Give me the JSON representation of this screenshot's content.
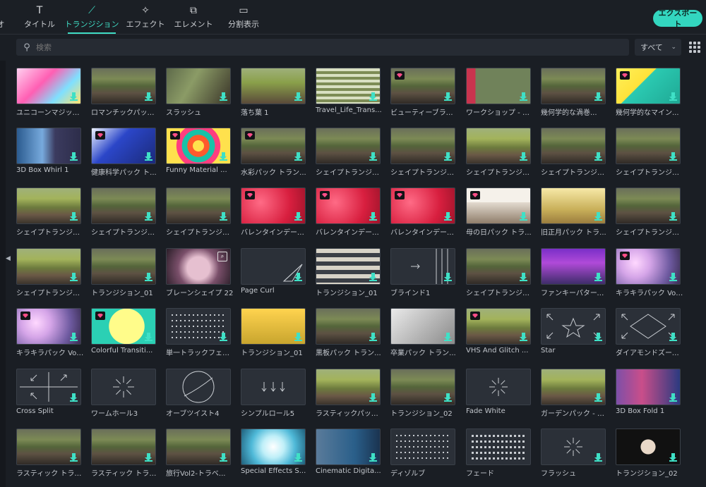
{
  "tabs": [
    {
      "label": "オ",
      "icon": "audio-icon",
      "active": false
    },
    {
      "label": "タイトル",
      "icon": "title-T-icon",
      "active": false
    },
    {
      "label": "トランジション",
      "icon": "transition-icon",
      "active": true
    },
    {
      "label": "エフェクト",
      "icon": "effect-icon",
      "active": false
    },
    {
      "label": "エレメント",
      "icon": "element-icon",
      "active": false
    },
    {
      "label": "分割表示",
      "icon": "split-screen-icon",
      "active": false
    }
  ],
  "export_label": "エクスポート",
  "search": {
    "placeholder": "検索"
  },
  "filter": {
    "value": "すべて"
  },
  "items": [
    {
      "label": "ユニコーンマジック...",
      "style": "p-pink",
      "gem": false,
      "dl": true
    },
    {
      "label": "ロマンチックパック ...",
      "style": "p-photo",
      "gem": false,
      "dl": true
    },
    {
      "label": "スラッシュ",
      "style": "p-slash",
      "gem": false,
      "dl": true
    },
    {
      "label": "落ち葉 1",
      "style": "p-leaf",
      "gem": false,
      "dl": true
    },
    {
      "label": "Travel_Life_Trans...",
      "style": "p-travel",
      "gem": false,
      "dl": true
    },
    {
      "label": "ビューティーブラシ - ...",
      "style": "p-photo",
      "gem": true,
      "dl": true
    },
    {
      "label": "ワークショップ - ト...",
      "style": "p-redbar",
      "gem": false,
      "dl": true
    },
    {
      "label": "幾何学的な渦巻...",
      "style": "p-photo",
      "gem": false,
      "dl": true
    },
    {
      "label": "幾何学的なマイン...",
      "style": "p-teal",
      "gem": true,
      "dl": true
    },
    {
      "label": "3D Box Whirl 1",
      "style": "p-box",
      "gem": false,
      "dl": true
    },
    {
      "label": "健康科学パック ト...",
      "style": "p-health",
      "gem": true,
      "dl": true
    },
    {
      "label": "Funny Material ...",
      "style": "p-funny",
      "gem": true,
      "dl": true
    },
    {
      "label": "水彩パック トラン...",
      "style": "p-photo",
      "gem": true,
      "dl": true
    },
    {
      "label": "シェイプトランジショ...",
      "style": "p-photo",
      "gem": false,
      "dl": true
    },
    {
      "label": "シェイプトランジショ...",
      "style": "p-photo",
      "gem": false,
      "dl": true
    },
    {
      "label": "シェイプトランジショ...",
      "style": "p-garden",
      "gem": false,
      "dl": true
    },
    {
      "label": "シェイプトランジショ...",
      "style": "p-photo",
      "gem": false,
      "dl": true
    },
    {
      "label": "シェイプトランジショ...",
      "style": "p-photo",
      "gem": false,
      "dl": true
    },
    {
      "label": "シェイプトランジショ...",
      "style": "p-garden",
      "gem": false,
      "dl": true
    },
    {
      "label": "シェイプトランジショ...",
      "style": "p-photo",
      "gem": false,
      "dl": true
    },
    {
      "label": "シェイプトランジショ...",
      "style": "p-photo",
      "gem": false,
      "dl": true
    },
    {
      "label": "バレンタインデーパ...",
      "style": "p-red",
      "gem": true,
      "dl": true
    },
    {
      "label": "バレンタインデーパ...",
      "style": "p-red",
      "gem": true,
      "dl": true
    },
    {
      "label": "バレンタインデーパ...",
      "style": "p-red",
      "gem": true,
      "dl": true
    },
    {
      "label": "母の日パック トラ...",
      "style": "p-mother",
      "gem": true,
      "dl": true
    },
    {
      "label": "旧正月パック トラ...",
      "style": "p-gold",
      "gem": false,
      "dl": true
    },
    {
      "label": "シェイプトランジショ...",
      "style": "p-photo",
      "gem": false,
      "dl": true
    },
    {
      "label": "シェイプトランジショ...",
      "style": "p-garden",
      "gem": false,
      "dl": true
    },
    {
      "label": "トランジション_01",
      "style": "p-photo",
      "gem": false,
      "dl": true
    },
    {
      "label": "ブレーンシェイプ 22",
      "style": "p-flower",
      "gem": false,
      "dl": false,
      "zoom": true
    },
    {
      "label": "Page Curl",
      "style": "p-dark",
      "gem": false,
      "dl": true,
      "icon": "pagecurl"
    },
    {
      "label": "トランジション_01",
      "style": "p-stripe",
      "gem": false,
      "dl": true
    },
    {
      "label": "ブラインド1",
      "style": "p-dark",
      "gem": false,
      "dl": true,
      "icon": "blind"
    },
    {
      "label": "シェイプトランジショ...",
      "style": "p-photo",
      "gem": false,
      "dl": true
    },
    {
      "label": "ファンキーパターンパ...",
      "style": "p-purple",
      "gem": false,
      "dl": true
    },
    {
      "label": "キラキラパック Vol ...",
      "style": "p-sparkle",
      "gem": true,
      "dl": true
    },
    {
      "label": "キラキラパック Vol ...",
      "style": "p-sparkle",
      "gem": true,
      "dl": true
    },
    {
      "label": "Colorful Transiti...",
      "style": "p-yellow",
      "gem": true,
      "dl": true
    },
    {
      "label": "単一トラックフェード",
      "style": "p-grid",
      "gem": false,
      "dl": true,
      "icon": "dots"
    },
    {
      "label": "トランジション_01",
      "style": "p-yelpanel",
      "gem": false,
      "dl": true
    },
    {
      "label": "黒板パック トラン...",
      "style": "p-photo",
      "gem": false,
      "dl": true
    },
    {
      "label": "卒業パック トラン...",
      "style": "p-sketch",
      "gem": false,
      "dl": true
    },
    {
      "label": "VHS And Glitch ...",
      "style": "p-garden",
      "gem": true,
      "dl": true
    },
    {
      "label": "Star",
      "style": "p-dark",
      "gem": false,
      "dl": true,
      "icon": "star"
    },
    {
      "label": "ダイアモンドズーム...",
      "style": "p-dark",
      "gem": false,
      "dl": true,
      "icon": "diamond"
    },
    {
      "label": "Cross Split",
      "style": "p-cross",
      "gem": false,
      "dl": true,
      "icon": "cross"
    },
    {
      "label": "ワームホール3",
      "style": "p-dark",
      "gem": false,
      "dl": false,
      "icon": "burst"
    },
    {
      "label": "オーブツイスト4",
      "style": "p-dark",
      "gem": false,
      "dl": false,
      "icon": "circle"
    },
    {
      "label": "シンプルロール5",
      "style": "p-dark",
      "gem": false,
      "dl": false,
      "icon": "roll"
    },
    {
      "label": "ラスティックパック -...",
      "style": "p-garden",
      "gem": false,
      "dl": true
    },
    {
      "label": "トランジション_02",
      "style": "p-photo",
      "gem": false,
      "dl": true
    },
    {
      "label": "Fade White",
      "style": "p-dark",
      "gem": false,
      "dl": false,
      "icon": "flash"
    },
    {
      "label": "ガーデンパック - ト...",
      "style": "p-garden",
      "gem": false,
      "dl": true
    },
    {
      "label": "3D Box Fold 1",
      "style": "p-fold",
      "gem": false,
      "dl": true
    },
    {
      "label": "ラスティック トラン...",
      "style": "p-photo",
      "gem": false,
      "dl": true
    },
    {
      "label": "ラスティック トラン...",
      "style": "p-photo",
      "gem": false,
      "dl": true
    },
    {
      "label": "旅行Vol2-トラベ...",
      "style": "p-photo",
      "gem": false,
      "dl": true
    },
    {
      "label": "Special Effects S...",
      "style": "p-cyan",
      "gem": false,
      "dl": true
    },
    {
      "label": "Cinematic Digita...",
      "style": "p-blue",
      "gem": false,
      "dl": true
    },
    {
      "label": "ディゾルブ",
      "style": "p-grid",
      "gem": false,
      "dl": false,
      "icon": "dots"
    },
    {
      "label": "フェード",
      "style": "p-grid",
      "gem": false,
      "dl": false,
      "icon": "dots2"
    },
    {
      "label": "フラッシュ",
      "style": "p-dark",
      "gem": false,
      "dl": true,
      "icon": "flash"
    },
    {
      "label": "トランジション_02",
      "style": "p-cluster",
      "gem": false,
      "dl": true
    }
  ]
}
